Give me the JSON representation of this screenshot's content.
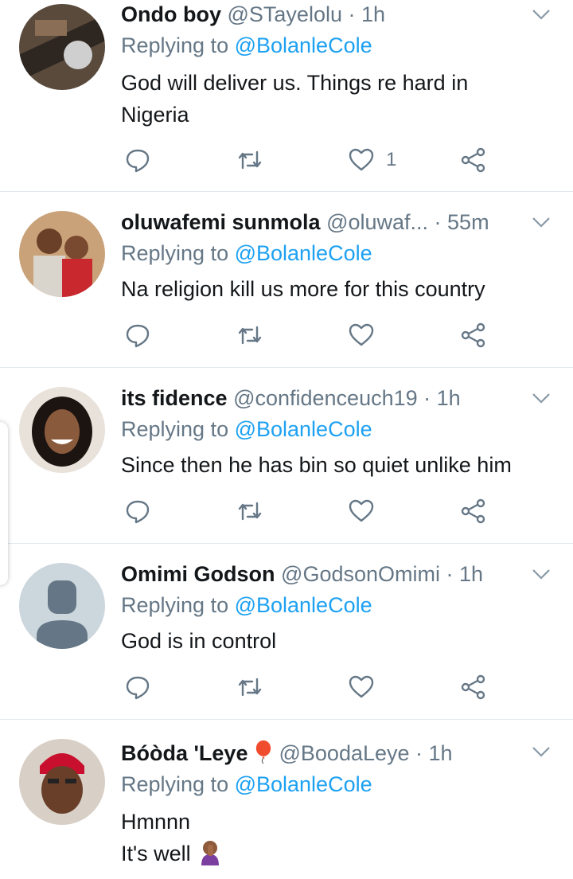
{
  "colors": {
    "link": "#1da1f2",
    "muted": "#657786",
    "text": "#14171a",
    "divider": "#e1e8ed"
  },
  "tweets": [
    {
      "name": "Ondo boy",
      "handle": "@STayelolu",
      "sep": " · ",
      "time": "1h",
      "replying_prefix": "Replying to ",
      "replying_to": "@BolanleCole",
      "lines": [
        "God will deliver us. Things re hard in",
        "Nigeria"
      ],
      "like_count": "1"
    },
    {
      "name": "oluwafemi sunmola",
      "handle": "@oluwaf...",
      "sep": " · ",
      "time": "55m",
      "replying_prefix": "Replying to ",
      "replying_to": "@BolanleCole",
      "lines": [
        "Na religion kill us more for this country"
      ],
      "like_count": ""
    },
    {
      "name": "its fidence",
      "handle": "@confidenceuch19",
      "sep": " · ",
      "time": "1h",
      "replying_prefix": "Replying to ",
      "replying_to": "@BolanleCole",
      "lines": [
        "Since then he has bin so quiet unlike him"
      ],
      "like_count": ""
    },
    {
      "name": "Omimi Godson",
      "handle": "@GodsonOmimi",
      "sep": " · ",
      "time": "1h",
      "replying_prefix": "Replying to ",
      "replying_to": "@BolanleCole",
      "lines": [
        "God is in control"
      ],
      "like_count": ""
    },
    {
      "name": "Bóòda 'Leye",
      "name_emoji": "balloon-emoji",
      "handle": "@BoodaLeye",
      "sep": " · ",
      "time": "1h",
      "replying_prefix": "Replying to ",
      "replying_to": "@BolanleCole",
      "lines": [
        "Hmnnn",
        "It's well"
      ],
      "line_emoji": "facepalm-emoji"
    }
  ]
}
